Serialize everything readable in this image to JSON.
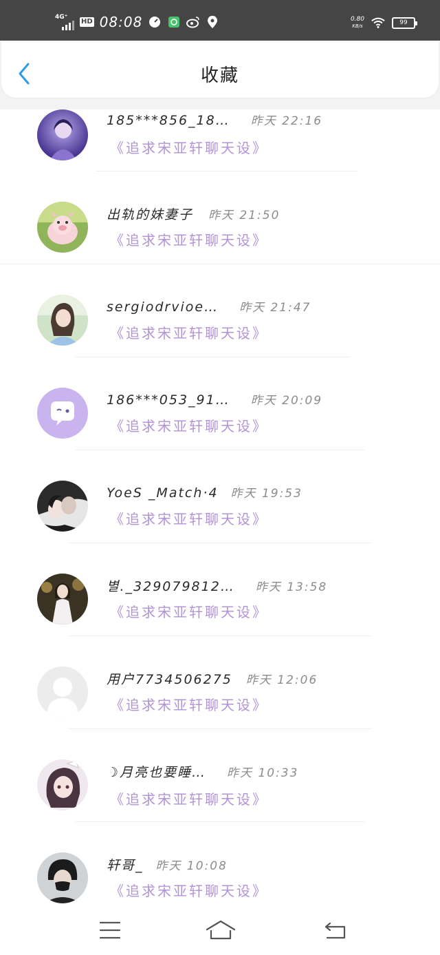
{
  "status_bar": {
    "network": "4G⁺",
    "hd": "HD",
    "time": "08:08",
    "speed_value": "0.80",
    "speed_unit": "KB/s",
    "battery": "99",
    "icons": [
      "speedometer-icon",
      "app-icon",
      "weibo-icon",
      "location-icon",
      "wifi-icon",
      "battery-icon"
    ]
  },
  "header": {
    "title": "收藏",
    "back_icon": "chevron-left-icon",
    "accent": "#2f9be8"
  },
  "colors": {
    "book_title": "#b294d6",
    "time": "#8c8c8c",
    "name": "#2a2a2a"
  },
  "items": [
    {
      "name": "185***856_18…",
      "time": "昨天 22:16",
      "book": "《追求宋亚轩聊天设》",
      "avatar": "avatar-purple-photo"
    },
    {
      "name": "出轨的妹妻子",
      "time": "昨天 21:50",
      "book": "《追求宋亚轩聊天设》",
      "avatar": "avatar-pig-toy"
    },
    {
      "name": "sergiodrvioe…",
      "time": "昨天 21:47",
      "book": "《追求宋亚轩聊天设》",
      "avatar": "avatar-girl-photo"
    },
    {
      "name": "186***053_91…",
      "time": "昨天 20:09",
      "book": "《追求宋亚轩聊天设》",
      "avatar": "avatar-chat-bubble"
    },
    {
      "name": "YoeS _Match·4",
      "time": "昨天 19:53",
      "book": "《追求宋亚轩聊天设》",
      "avatar": "avatar-couple-photo"
    },
    {
      "name": "별._329079812…",
      "time": "昨天 13:58",
      "book": "《追求宋亚轩聊天设》",
      "avatar": "avatar-dress-photo"
    },
    {
      "name": "用户7734506275",
      "time": "昨天 12:06",
      "book": "《追求宋亚轩聊天设》",
      "avatar": "avatar-default-user"
    },
    {
      "name": "☽月亮也要睡…",
      "time": "昨天 10:33",
      "book": "《追求宋亚轩聊天设》",
      "avatar": "avatar-anime-girl"
    },
    {
      "name": "轩哥_",
      "time": "昨天 10:08",
      "book": "《追求宋亚轩聊天设》",
      "avatar": "avatar-masked-man"
    }
  ],
  "navbar": {
    "icons": [
      "menu-icon",
      "home-icon",
      "back-icon"
    ]
  }
}
